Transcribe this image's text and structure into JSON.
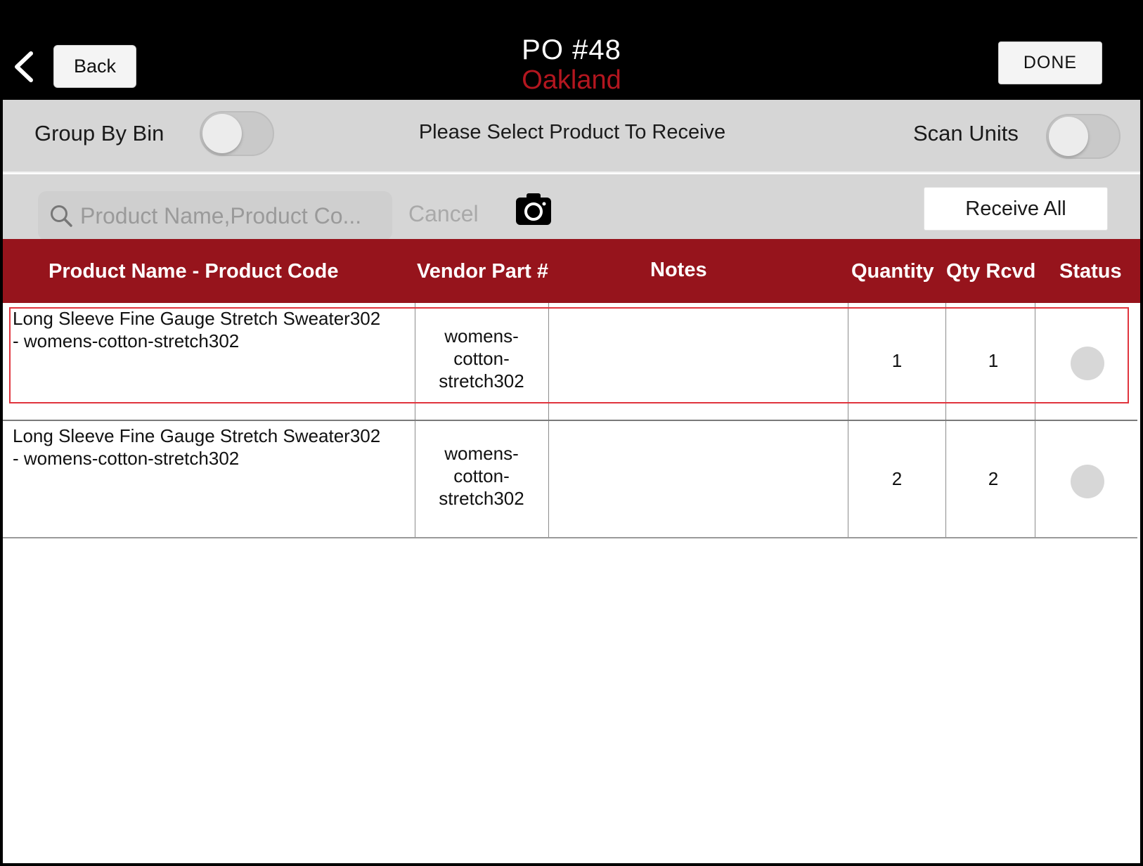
{
  "header": {
    "back_label": "Back",
    "title": "PO #48",
    "location": "Oakland",
    "done_label": "DONE"
  },
  "options": {
    "group_by_bin_label": "Group By Bin",
    "group_by_bin_on": false,
    "instruction": "Please Select Product To Receive",
    "scan_units_label": "Scan Units",
    "scan_units_on": false
  },
  "search": {
    "placeholder": "Product Name,Product Co...",
    "cancel_label": "Cancel",
    "receive_all_label": "Receive All"
  },
  "table": {
    "columns": [
      "Product Name - Product Code",
      "Vendor Part #",
      "Notes",
      "Quantity",
      "Qty Rcvd",
      "Status"
    ],
    "rows": [
      {
        "name_line1": "Long Sleeve Fine Gauge Stretch Sweater302",
        "name_line2": "- womens-cotton-stretch302",
        "vendor_line1": "womens-",
        "vendor_line2": "cotton-",
        "vendor_line3": "stretch302",
        "notes": "",
        "quantity": "1",
        "qty_rcvd": "1",
        "selected": true
      },
      {
        "name_line1": "Long Sleeve Fine Gauge Stretch Sweater302",
        "name_line2": "- womens-cotton-stretch302",
        "vendor_line1": "womens-",
        "vendor_line2": "cotton-",
        "vendor_line3": "stretch302",
        "notes": "",
        "quantity": "2",
        "qty_rcvd": "2",
        "selected": false
      }
    ]
  },
  "colors": {
    "header_bg": "#000000",
    "accent_red": "#96141c",
    "location_red": "#b3161f",
    "selection_outline": "#e0343d",
    "bar_gray": "#d6d6d6"
  },
  "icons": [
    "chevron-left-icon",
    "search-icon",
    "camera-icon"
  ]
}
